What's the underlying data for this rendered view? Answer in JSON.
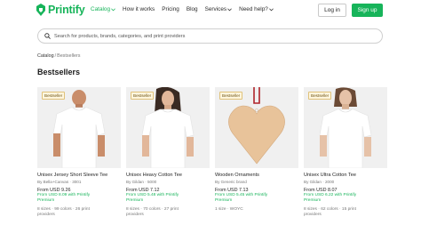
{
  "header": {
    "brand": "Printify",
    "nav": [
      {
        "label": "Catalog",
        "has_dropdown": true,
        "active": true
      },
      {
        "label": "How it works",
        "has_dropdown": false,
        "active": false
      },
      {
        "label": "Pricing",
        "has_dropdown": false,
        "active": false
      },
      {
        "label": "Blog",
        "has_dropdown": false,
        "active": false
      },
      {
        "label": "Services",
        "has_dropdown": true,
        "active": false
      },
      {
        "label": "Need help?",
        "has_dropdown": true,
        "active": false
      }
    ],
    "login_label": "Log in",
    "signup_label": "Sign up"
  },
  "search": {
    "placeholder": "Search for products, brands, categories, and print providers"
  },
  "breadcrumb": {
    "parent": "Catalog",
    "separator": "/",
    "current": "Bestsellers"
  },
  "page_title": "Bestsellers",
  "products": [
    {
      "badge": "Bestseller",
      "title": "Unisex Jersey Short Sleeve Tee",
      "by": "By Bella+Canvas · 3001",
      "price": "From USD 9.26",
      "premium_line1": "From USD 8.09 with Printify",
      "premium_line2": "Premium",
      "meta_line1": "8 sizes · 99 colors · 26 print",
      "meta_line2": "providers",
      "icon": "tshirt-male-model"
    },
    {
      "badge": "Bestseller",
      "title": "Unisex Heavy Cotton Tee",
      "by": "By Gildan · 5000",
      "price": "From USD 7.12",
      "premium_line1": "From USD 5.48 with Printify",
      "premium_line2": "Premium",
      "meta_line1": "8 sizes · 70 colors · 27 print",
      "meta_line2": "providers",
      "icon": "tshirt-female-model"
    },
    {
      "badge": "Bestseller",
      "title": "Wooden Ornaments",
      "by": "By Generic brand",
      "price": "From USD 7.13",
      "premium_line1": "From USD 5.45 with Printify",
      "premium_line2": "Premium",
      "meta_line1": "1 size · WOYC",
      "meta_line2": "",
      "icon": "heart-ornament"
    },
    {
      "badge": "Bestseller",
      "title": "Unisex Ultra Cotton Tee",
      "by": "By Gildan · 2000",
      "price": "From USD 8.07",
      "premium_line1": "From USD 6.22 with Printify",
      "premium_line2": "Premium",
      "meta_line1": "8 sizes · 62 colors · 15 print",
      "meta_line2": "providers",
      "icon": "tshirt-female-model"
    }
  ],
  "colors": {
    "brand_green": "#17b45a",
    "badge_bg": "#fff6de",
    "badge_border": "#e0c27a"
  }
}
